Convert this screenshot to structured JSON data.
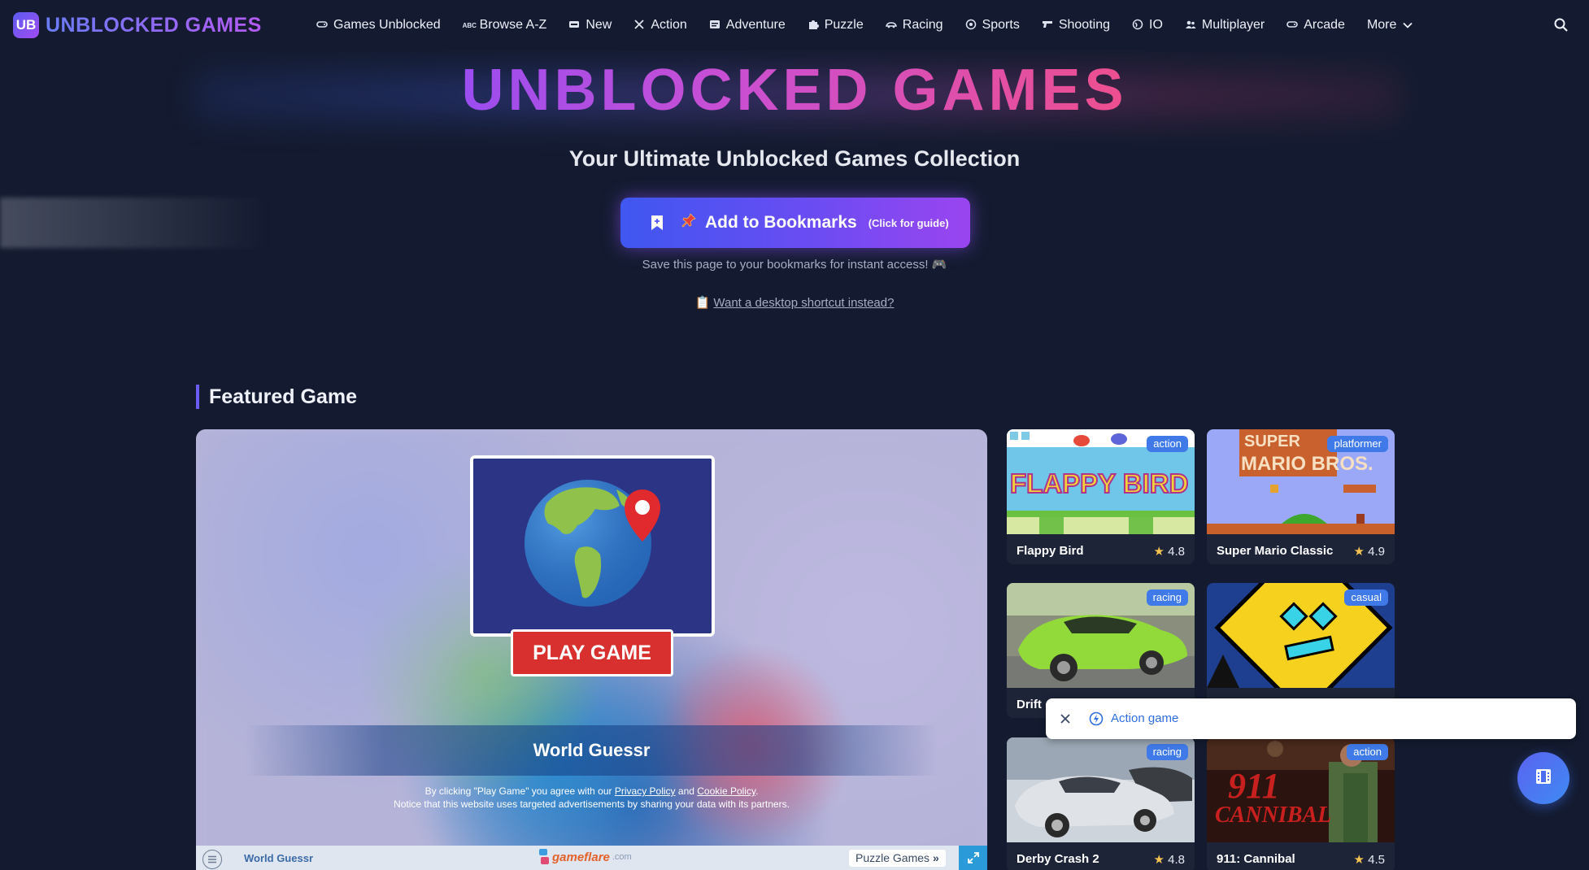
{
  "nav": {
    "logo_badge": "UB",
    "logo_text": "UNBLOCKED GAMES",
    "items": [
      {
        "label": "Games Unblocked",
        "icon": "gamepad-icon"
      },
      {
        "label": "Browse A-Z",
        "icon": "abc-icon"
      },
      {
        "label": "New",
        "icon": "new-icon"
      },
      {
        "label": "Action",
        "icon": "swords-icon"
      },
      {
        "label": "Adventure",
        "icon": "map-icon"
      },
      {
        "label": "Puzzle",
        "icon": "puzzle-icon"
      },
      {
        "label": "Racing",
        "icon": "car-icon"
      },
      {
        "label": "Sports",
        "icon": "ball-icon"
      },
      {
        "label": "Shooting",
        "icon": "gun-icon"
      },
      {
        "label": "IO",
        "icon": "globe-icon"
      },
      {
        "label": "Multiplayer",
        "icon": "users-icon"
      },
      {
        "label": "Arcade",
        "icon": "gamepad-icon"
      }
    ],
    "more_label": "More"
  },
  "hero": {
    "title": "UNBLOCKED GAMES",
    "subtitle": "Your Ultimate Unblocked Games Collection",
    "bookmark_label": "Add to Bookmarks",
    "bookmark_hint": "(Click for guide)",
    "save_note": "Save this page to your bookmarks for instant access! 🎮",
    "shortcut_prefix": "📋",
    "shortcut_link": "Want a desktop shortcut instead?"
  },
  "featured": {
    "section_title": "Featured Game",
    "play_label": "PLAY GAME",
    "game_title": "World Guessr",
    "legal_prefix": "By clicking \"Play Game\" you agree with our ",
    "privacy": "Privacy Policy",
    "and": " and ",
    "cookie": "Cookie Policy",
    "legal_suffix": ".",
    "legal_line2": "Notice that this website uses targeted advertisements by sharing your data with its partners.",
    "bar_game_name": "World Guessr",
    "bar_brand": "gameflare",
    "bar_brand_suffix": ".com",
    "bar_category": "Puzzle Games"
  },
  "cards": [
    {
      "name": "Flappy Bird",
      "rating": "4.8",
      "tag": "action"
    },
    {
      "name": "Super Mario Classic",
      "rating": "4.9",
      "tag": "platformer"
    },
    {
      "name": "Drift",
      "rating": "",
      "tag": "racing"
    },
    {
      "name": "",
      "rating": "",
      "tag": "casual"
    },
    {
      "name": "Derby Crash 2",
      "rating": "4.8",
      "tag": "racing"
    },
    {
      "name": "911: Cannibal",
      "rating": "4.5",
      "tag": "action"
    }
  ],
  "thumb_text": {
    "flappy": "FLAPPY BIRD",
    "mario_top": "SUPER",
    "mario_bottom": "MARIO BROS.",
    "cannibal_top": "911",
    "cannibal_bottom": "CANNIBAL"
  },
  "tooltip": {
    "label": "Action game"
  },
  "colors": {
    "background": "#141b30",
    "accent": "#6b4cf3",
    "tag": "#3f7ae8",
    "play": "#d8302e"
  }
}
